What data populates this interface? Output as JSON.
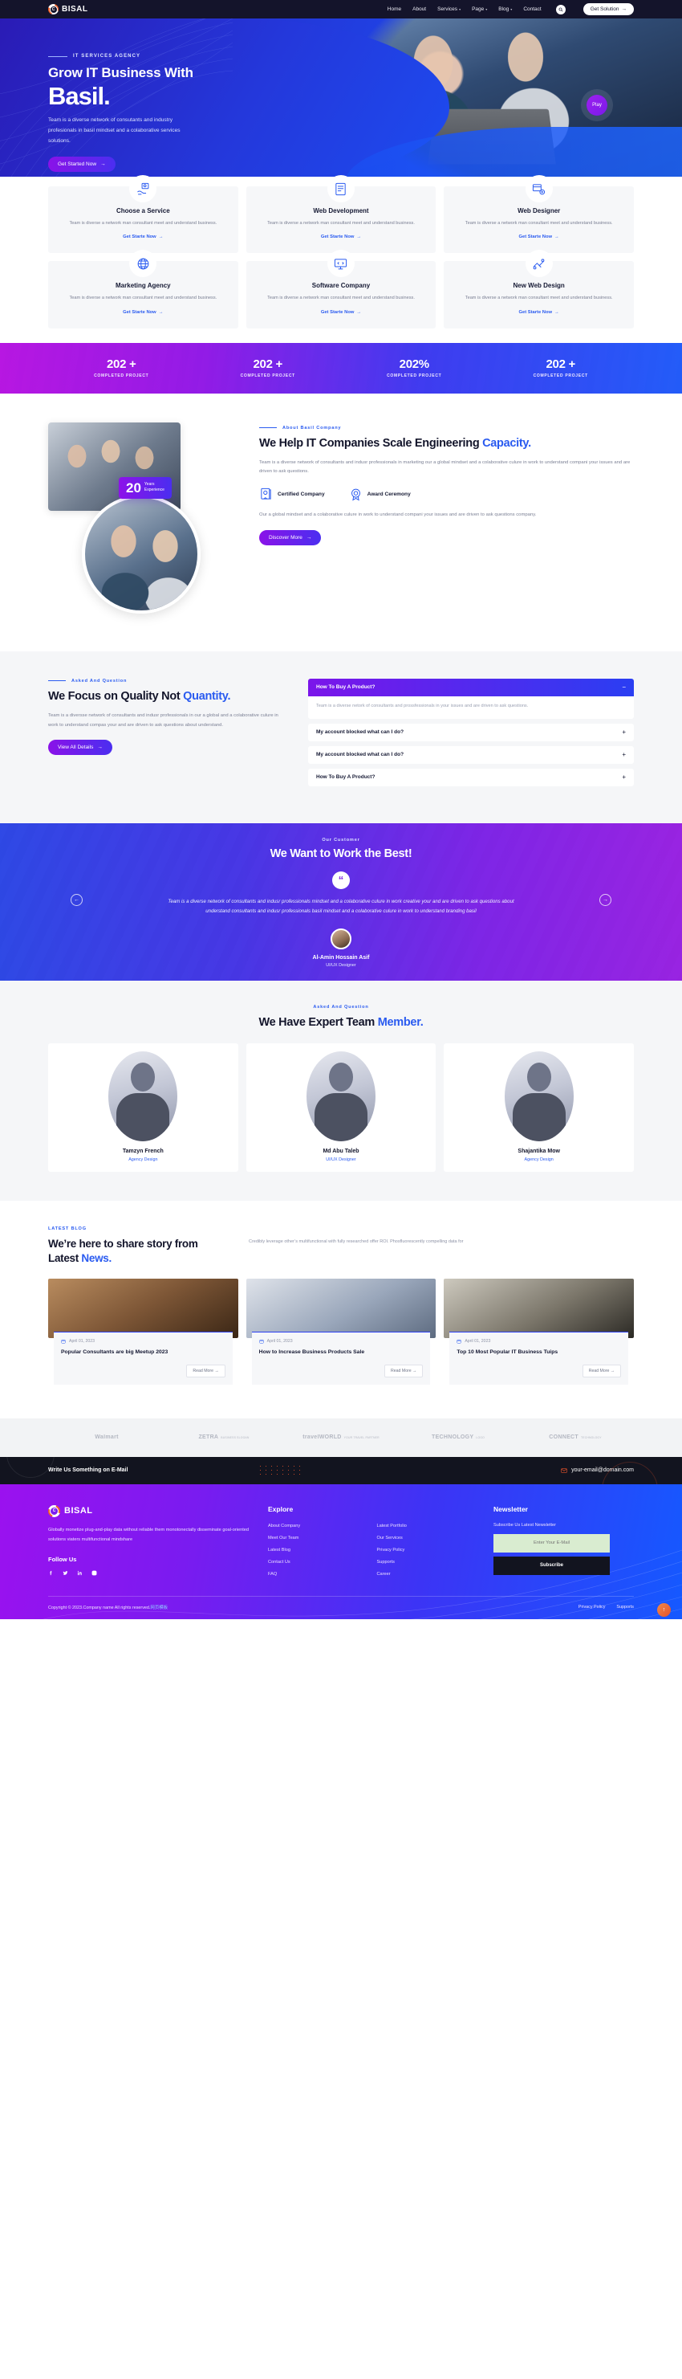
{
  "header": {
    "brand": "BISAL",
    "nav": [
      {
        "label": "Home",
        "caret": false
      },
      {
        "label": "About",
        "caret": false
      },
      {
        "label": "Services",
        "caret": true
      },
      {
        "label": "Page",
        "caret": true
      },
      {
        "label": "Blog",
        "caret": true
      },
      {
        "label": "Contact",
        "caret": false
      }
    ],
    "search_icon": "search-icon",
    "cta": "Get Solution",
    "cta_arrow": "→"
  },
  "hero": {
    "eyebrow": "IT SERVICES AGENCY",
    "title_line1": "Grow IT Business With",
    "title_line2": "Basil.",
    "paragraph": "Team is a diverse network of consutants and industry profesionals in basil mindset and a colaborative services solutions.",
    "button": "Get Started Now",
    "button_arrow": "→",
    "play": "Play"
  },
  "services": {
    "cards": [
      {
        "icon": "service-gear-hand-icon",
        "title": "Choose a Service",
        "desc": "Team is diverse a network man consultant meet and understand business.",
        "link": "Get Starte Now"
      },
      {
        "icon": "web-development-icon",
        "title": "Web Development",
        "desc": "Team is diverse a network man consultant meet and understand business.",
        "link": "Get Starte Now"
      },
      {
        "icon": "web-designer-icon",
        "title": "Web Designer",
        "desc": "Team is diverse a network man consultant meet and understand business.",
        "link": "Get Starte Now"
      },
      {
        "icon": "marketing-agency-icon",
        "title": "Marketing Agency",
        "desc": "Team is diverse a network man consultant meet and understand business.",
        "link": "Get Starte Now"
      },
      {
        "icon": "software-company-icon",
        "title": "Software Company",
        "desc": "Team is diverse a network man consultant meet and understand business.",
        "link": "Get Starte Now"
      },
      {
        "icon": "new-web-design-icon",
        "title": "New Web Design",
        "desc": "Team is diverse a network man consultant meet and understand business.",
        "link": "Get Starte Now"
      }
    ],
    "link_arrow": "→"
  },
  "counters": [
    {
      "value": "202 +",
      "label": "COMPLETED PROJECT"
    },
    {
      "value": "202 +",
      "label": "COMPLETED PROJECT"
    },
    {
      "value": "202%",
      "label": "COMPLETED PROJECT"
    },
    {
      "value": "202 +",
      "label": "COMPLETED PROJECT"
    }
  ],
  "about": {
    "badge_number": "20",
    "badge_line1": "Years",
    "badge_line2": "Experience",
    "eyebrow": "About Basil Company",
    "heading_part1": "We Help IT Companies Scale Engineering ",
    "heading_highlight": "Capacity.",
    "lead": "Team is a diverse network of consultants and indusr professionals in marketing our a global mindset and a colaborative culure in work to understand compani your issues and are driven to ask questions.",
    "features": [
      {
        "icon": "certificate-icon",
        "label": "Certified Company"
      },
      {
        "icon": "award-badge-icon",
        "label": "Award Ceremony"
      }
    ],
    "sub": "Our a global mindset and a colaborative culure in work to understand compani your issues and are driven to ask questions company.",
    "button": "Discover More",
    "button_arrow": "→"
  },
  "faq": {
    "eyebrow": "Asked And Question",
    "heading_part1": "We Focus on Quality Not ",
    "heading_highlight": "Quantity.",
    "paragraph": "Team is a diversse network of consultants and indusr professionals in our a global and a colaborative culure in work to understand compas your and are driven to ask questions about understand.",
    "button": "View All Details",
    "button_arrow": "→",
    "items": [
      {
        "question": "How To Buy A Product?",
        "open": true,
        "sign": "−",
        "answer": "Team is a diverse netork of consultants and prossfessionals in your issues and are driven to ask questions."
      },
      {
        "question": "My account blocked what can I do?",
        "open": false,
        "sign": "+",
        "answer": ""
      },
      {
        "question": "My account blocked what can I do?",
        "open": false,
        "sign": "+",
        "answer": ""
      },
      {
        "question": "How To Buy A Product?",
        "open": false,
        "sign": "+",
        "answer": ""
      }
    ]
  },
  "testimonial": {
    "eyebrow": "Our Customer",
    "heading": "We Want to Work the Best!",
    "quote_mark": "“",
    "quote": "Team is a diverse network of consultants and indusr professionals mindset and a colaborative culure in work creative your and are driven to ask questions about understand consultants and indusr professionals basil mindset and a colaborative culure in work to understand branding basil",
    "name": "Al-Amin Hossain Asif",
    "role": "UI/UX Designer",
    "prev_arrow": "←",
    "next_arrow": "→"
  },
  "team": {
    "eyebrow": "Asked And Question",
    "heading_part1": "We Have Expert Team ",
    "heading_highlight": "Member.",
    "members": [
      {
        "name": "Tamzyn French",
        "role": "Agency Design"
      },
      {
        "name": "Md Abu Taleb",
        "role": "UI/UX Designer"
      },
      {
        "name": "Shajantika Mow",
        "role": "Agency Design"
      }
    ]
  },
  "blog": {
    "eyebrow": "LATEST BLOG",
    "heading_part1": "We’re here to share story from Latest ",
    "heading_highlight": "News.",
    "paragraph": "Credibly leverage other’s multifunctional with fully researched offer ROI. Phosfluorescently compelling data for",
    "posts": [
      {
        "date": "April 01, 2023",
        "title": "Popular Consultants are big Meetup 2023",
        "readmore": "Read More →"
      },
      {
        "date": "April 01, 2023",
        "title": "How to Increase Business Products Sale",
        "readmore": "Read More →"
      },
      {
        "date": "April 01, 2023",
        "title": "Top 10 Most Popular IT Business Tuips",
        "readmore": "Read More →"
      }
    ],
    "date_icon": "calendar-icon"
  },
  "brands": [
    {
      "name": "Walmart",
      "sub": ""
    },
    {
      "name": "ZETRA",
      "sub": "BUSINESS SLOGAN"
    },
    {
      "name": "travelWORLD",
      "sub": "YOUR TRAVEL PARTNER"
    },
    {
      "name": "TECHNOLOGY",
      "sub": "LOGO"
    },
    {
      "name": "CONNECT",
      "sub": "TECHNOLOGY"
    }
  ],
  "mailstrip": {
    "text": "Write Us Something on E-Mail",
    "email": "your-email@domain.com",
    "mail_icon": "mail-icon"
  },
  "footer": {
    "brand": "BISAL",
    "about": "Globally monetize plug-and-play data without reliable them monotonectally disseminate goal-oriented solutions viaters multifunctional mindshare",
    "follow_title": "Follow Us",
    "socials": [
      "facebook-icon",
      "twitter-icon",
      "linkedin-icon",
      "instagram-icon"
    ],
    "explore_title": "Explore",
    "explore_links": [
      "About Company",
      "Latest Portfolio",
      "Meet Our Team",
      "Our Services",
      "Latest Blog",
      "Privacy Policy",
      "Contact Us",
      "Supports",
      "FAQ",
      "Career"
    ],
    "newsletter_title": "Newsletter",
    "newsletter_sub": "Subscribe Us Latest Newsletter",
    "email_placeholder": "Enter Your E-Mail",
    "subscribe_button": "Subscribe",
    "copyright": "Copyright © 2023.Company name All rights reserved.",
    "copyright_cn": "网页模板",
    "bottom_links": [
      "Privacy Policy",
      "Supports"
    ],
    "to_top": "↑"
  },
  "colors": {
    "brand_blue": "#2a5bf0",
    "brand_purple": "#8a12e8",
    "dark": "#14142b",
    "orange": "#e4512a"
  }
}
